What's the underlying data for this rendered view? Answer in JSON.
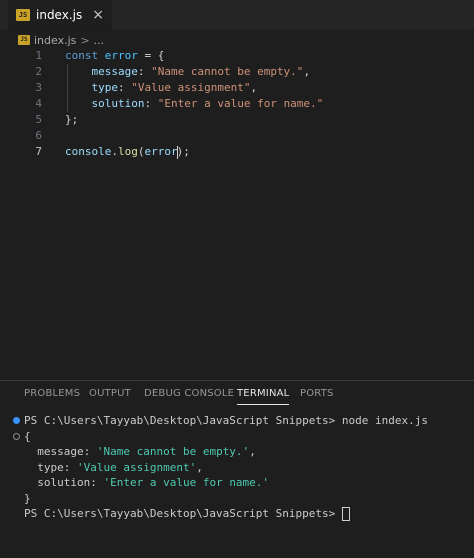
{
  "tab": {
    "icon": "JS",
    "label": "index.js",
    "close": "×"
  },
  "breadcrumb": {
    "file": "index.js",
    "sep": ">",
    "more": "..."
  },
  "editor": {
    "lines": [
      {
        "num": "1",
        "tokens": [
          [
            "kw",
            "const "
          ],
          [
            "var",
            "error"
          ],
          [
            "plain",
            " = {"
          ]
        ]
      },
      {
        "num": "2",
        "tokens": [
          [
            "plain",
            "    "
          ],
          [
            "prop",
            "message"
          ],
          [
            "plain",
            ": "
          ],
          [
            "str",
            "\"Name cannot be empty.\""
          ],
          [
            "plain",
            ","
          ]
        ]
      },
      {
        "num": "3",
        "tokens": [
          [
            "plain",
            "    "
          ],
          [
            "prop",
            "type"
          ],
          [
            "plain",
            ": "
          ],
          [
            "str",
            "\"Value assignment\""
          ],
          [
            "plain",
            ","
          ]
        ]
      },
      {
        "num": "4",
        "tokens": [
          [
            "plain",
            "    "
          ],
          [
            "prop",
            "solution"
          ],
          [
            "plain",
            ": "
          ],
          [
            "str",
            "\"Enter a value for name.\""
          ]
        ]
      },
      {
        "num": "5",
        "tokens": [
          [
            "plain",
            "};"
          ]
        ]
      },
      {
        "num": "6",
        "tokens": []
      },
      {
        "num": "7",
        "tokens": [
          [
            "prop",
            "console"
          ],
          [
            "plain",
            "."
          ],
          [
            "fn",
            "log"
          ],
          [
            "bracket",
            "("
          ],
          [
            "prop",
            "error"
          ],
          [
            "cursor",
            ""
          ],
          [
            "bracket",
            ")"
          ],
          [
            "plain",
            ";"
          ]
        ]
      }
    ],
    "active_line": "7"
  },
  "panel": {
    "tabs": [
      "PROBLEMS",
      "OUTPUT",
      "DEBUG CONSOLE",
      "TERMINAL",
      "PORTS"
    ],
    "active_tab": "TERMINAL"
  },
  "terminal": {
    "lines": [
      {
        "marker": "filled",
        "tokens": [
          [
            "tprop",
            "PS C:\\Users\\Tayyab\\Desktop\\JavaScript Snippets> node index.js"
          ]
        ]
      },
      {
        "marker": "hollow",
        "tokens": [
          [
            "tprop",
            "{"
          ]
        ]
      },
      {
        "marker": "",
        "tokens": [
          [
            "tprop",
            "  message: "
          ],
          [
            "tstr",
            "'Name cannot be empty.'"
          ],
          [
            "tprop",
            ","
          ]
        ]
      },
      {
        "marker": "",
        "tokens": [
          [
            "tprop",
            "  type: "
          ],
          [
            "tstr",
            "'Value assignment'"
          ],
          [
            "tprop",
            ","
          ]
        ]
      },
      {
        "marker": "",
        "tokens": [
          [
            "tprop",
            "  solution: "
          ],
          [
            "tstr",
            "'Enter a value for name.'"
          ]
        ]
      },
      {
        "marker": "",
        "tokens": [
          [
            "tprop",
            "}"
          ]
        ]
      },
      {
        "marker": "",
        "tokens": [
          [
            "tprop",
            "PS C:\\Users\\Tayyab\\Desktop\\JavaScript Snippets> "
          ],
          [
            "termcursor",
            ""
          ]
        ]
      }
    ]
  },
  "colors": {
    "editor_bg": "#1e1e1e",
    "keyword": "#569cd6",
    "string": "#ce9178",
    "property": "#9cdcfe",
    "function": "#dcdcaa",
    "terminal_string": "#4ec9b0",
    "accent": "#3794ff"
  }
}
